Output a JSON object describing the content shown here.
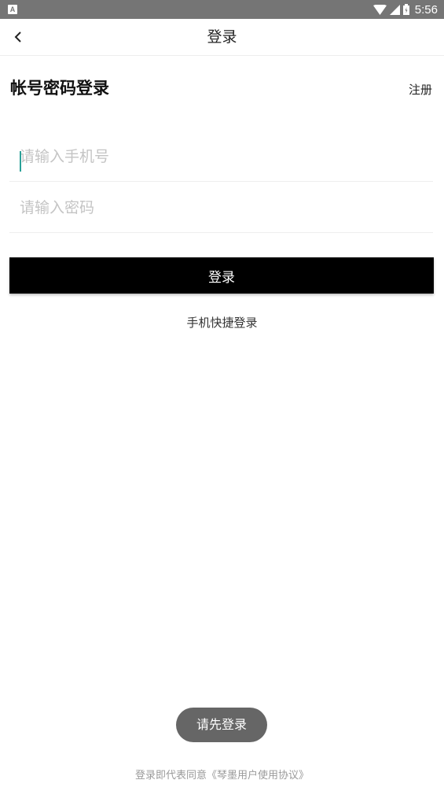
{
  "status_bar": {
    "app_icon_letter": "A",
    "time": "5:56"
  },
  "nav": {
    "title": "登录"
  },
  "heading": {
    "title": "帐号密码登录",
    "register_label": "注册"
  },
  "form": {
    "phone_placeholder": "请输入手机号",
    "phone_value": "",
    "password_placeholder": "请输入密码",
    "password_value": ""
  },
  "actions": {
    "login_label": "登录",
    "quick_login_label": "手机快捷登录"
  },
  "toast": {
    "message": "请先登录"
  },
  "footer": {
    "agreement_prefix": "登录即代表同意",
    "agreement_link": "《琴墨用户使用协议》"
  },
  "colors": {
    "primary_button": "#000000",
    "toast_bg": "#666666",
    "status_bar_bg": "#757575",
    "caret": "#2aa198"
  }
}
